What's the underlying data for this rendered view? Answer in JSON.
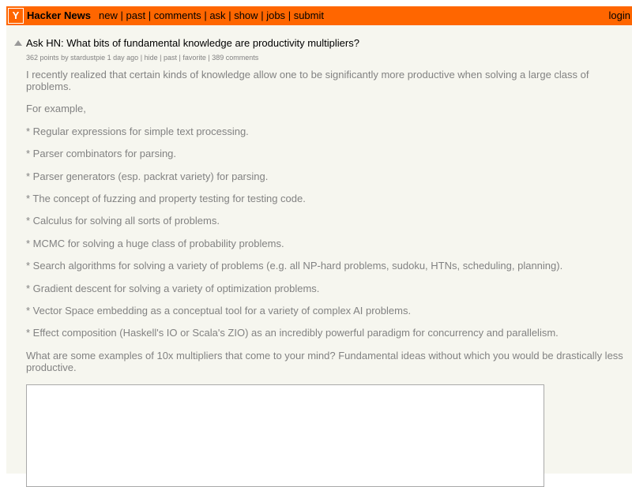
{
  "header": {
    "logo_letter": "Y",
    "site_name": "Hacker News",
    "nav": [
      "new",
      "past",
      "comments",
      "ask",
      "show",
      "jobs",
      "submit"
    ],
    "separator": "|",
    "login": "login",
    "brand_color": "#ff6600"
  },
  "story": {
    "title": "Ask HN: What bits of fundamental knowledge are productivity multipliers?",
    "points": "362 points",
    "by_label": "by",
    "user": "stardustpie",
    "age": "1 day ago",
    "hide": "hide",
    "past": "past",
    "favorite": "favorite",
    "comments": "389 comments"
  },
  "body": {
    "paragraphs": [
      "I recently realized that certain kinds of knowledge allow one to be significantly more productive when solving a large class of problems.",
      "For example,",
      "* Regular expressions for simple text processing.",
      "* Parser combinators for parsing.",
      "* Parser generators (esp. packrat variety) for parsing.",
      "* The concept of fuzzing and property testing for testing code.",
      "* Calculus for solving all sorts of problems.",
      "* MCMC for solving a huge class of probability problems.",
      "* Search algorithms for solving a variety of problems (e.g. all NP-hard problems, sudoku, HTNs, scheduling, planning).",
      "* Gradient descent for solving a variety of optimization problems.",
      "* Vector Space embedding as a conceptual tool for a variety of complex AI problems.",
      "* Effect composition (Haskell's IO or Scala's ZIO) as an incredibly powerful paradigm for concurrency and parallelism.",
      "What are some examples of 10x multipliers that come to your mind? Fundamental ideas without which you would be drastically less productive."
    ]
  },
  "comment_form": {
    "value": ""
  }
}
